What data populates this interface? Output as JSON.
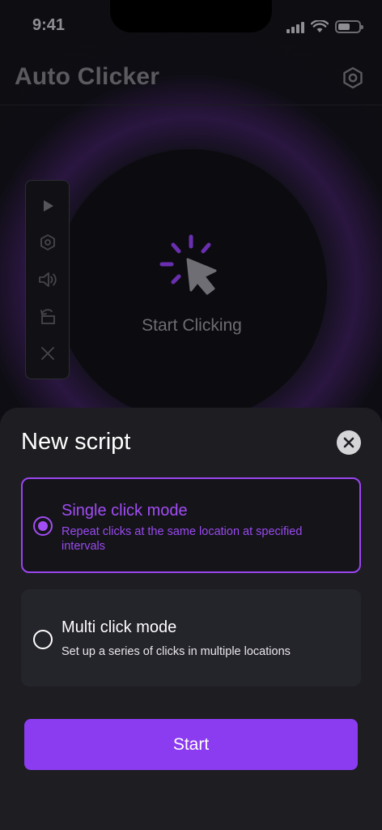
{
  "status_bar": {
    "time": "9:41"
  },
  "app": {
    "title": "Auto Clicker",
    "main_label": "Start Clicking",
    "floating_tools": [
      {
        "icon": "play-icon"
      },
      {
        "icon": "settings-hex-icon"
      },
      {
        "icon": "speaker-icon"
      },
      {
        "icon": "rotate-icon"
      },
      {
        "icon": "close-x-icon"
      }
    ]
  },
  "sheet": {
    "title": "New script",
    "options": [
      {
        "title": "Single click mode",
        "description": "Repeat clicks at the same location at specified intervals",
        "selected": true
      },
      {
        "title": "Multi click mode",
        "description": "Set up a series of clicks in multiple locations",
        "selected": false
      }
    ],
    "start_label": "Start"
  },
  "colors": {
    "accent": "#8b3cf0",
    "accent_text": "#a24df4",
    "sheet_bg": "#1d1d22"
  }
}
